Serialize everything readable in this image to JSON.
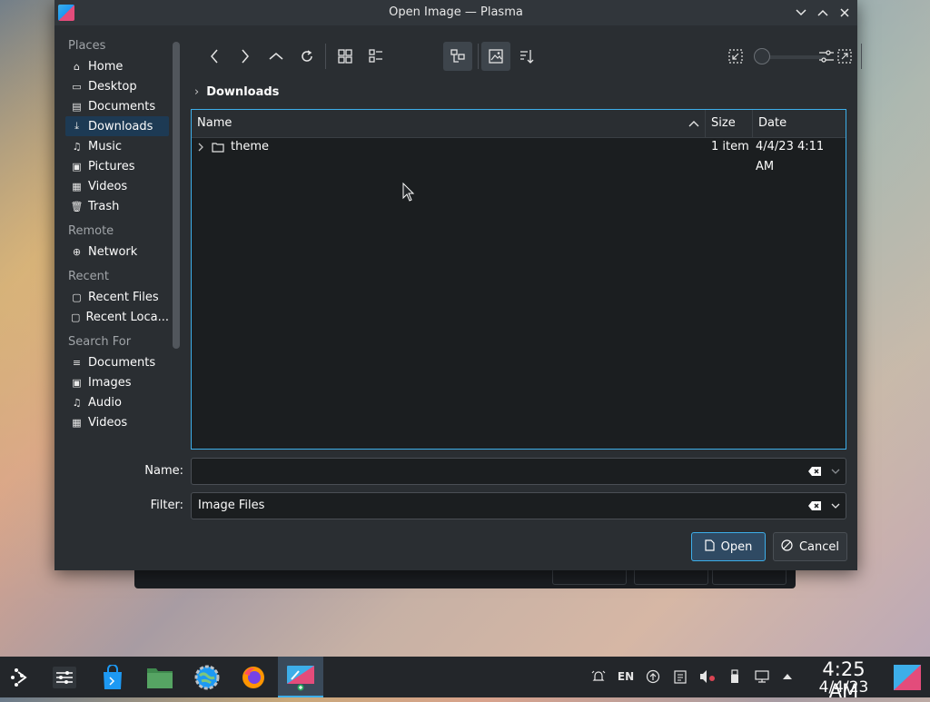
{
  "window": {
    "title": "Open Image — Plasma"
  },
  "sidebar": {
    "sections": [
      {
        "label": "Places",
        "items": [
          {
            "label": "Home",
            "icon": "home-icon"
          },
          {
            "label": "Desktop",
            "icon": "desktop-icon"
          },
          {
            "label": "Documents",
            "icon": "documents-icon"
          },
          {
            "label": "Downloads",
            "icon": "downloads-icon",
            "active": true
          },
          {
            "label": "Music",
            "icon": "music-icon"
          },
          {
            "label": "Pictures",
            "icon": "pictures-icon"
          },
          {
            "label": "Videos",
            "icon": "videos-icon"
          },
          {
            "label": "Trash",
            "icon": "trash-icon"
          }
        ]
      },
      {
        "label": "Remote",
        "items": [
          {
            "label": "Network",
            "icon": "network-icon"
          }
        ]
      },
      {
        "label": "Recent",
        "items": [
          {
            "label": "Recent Files",
            "icon": "recent-files-icon"
          },
          {
            "label": "Recent Loca...",
            "icon": "recent-locations-icon"
          }
        ]
      },
      {
        "label": "Search For",
        "items": [
          {
            "label": "Documents",
            "icon": "search-documents-icon"
          },
          {
            "label": "Images",
            "icon": "search-images-icon"
          },
          {
            "label": "Audio",
            "icon": "search-audio-icon"
          },
          {
            "label": "Videos",
            "icon": "search-videos-icon"
          }
        ]
      }
    ]
  },
  "breadcrumb": {
    "current": "Downloads"
  },
  "fileview": {
    "columns": {
      "name": "Name",
      "size": "Size",
      "date": "Date"
    },
    "rows": [
      {
        "name": "theme",
        "size": "1 item",
        "date": "4/4/23 4:11 AM"
      }
    ]
  },
  "form": {
    "name_label": "Name:",
    "name_value": "",
    "filter_label": "Filter:",
    "filter_value": "Image Files"
  },
  "buttons": {
    "open": "Open",
    "cancel": "Cancel"
  },
  "taskbar": {
    "language": "EN",
    "time": "4:25 AM",
    "date": "4/4/23"
  },
  "colors": {
    "accent": "#3daee9",
    "window_bg": "#2a2e32",
    "view_bg": "#1b1e20",
    "selection": "#1d3a54"
  }
}
